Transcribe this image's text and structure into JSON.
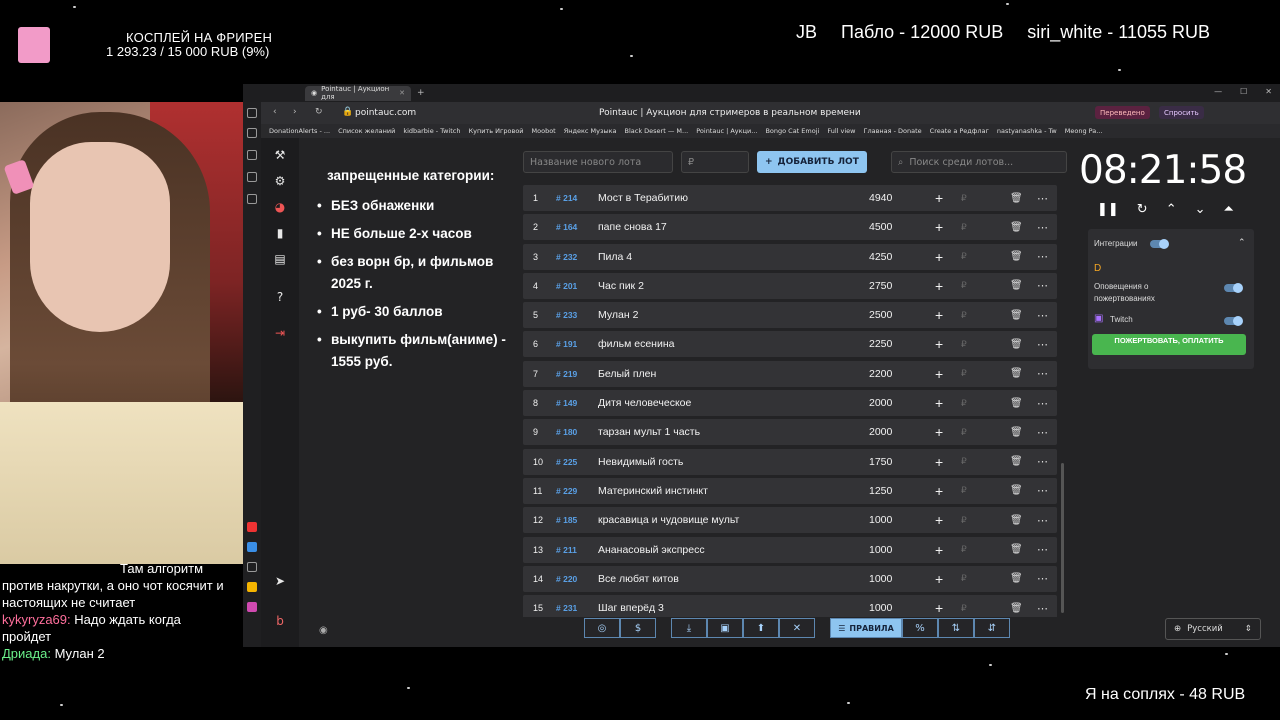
{
  "overlay": {
    "goal_title": "КОСПЛЕЙ НА ФРИРЕН",
    "goal_progress": "1 293.23 / 15 000 RUB (9%)",
    "top_donors": [
      "JB",
      "Пабло - 12000 RUB",
      "siri_white - 11055 RUB"
    ],
    "bottom_right": "Я на соплях - 48 RUB"
  },
  "chat": {
    "messages": [
      {
        "user": "",
        "text": "Там алгоритм"
      },
      {
        "user": "",
        "text": "против накрутки, а оно чот косячит и"
      },
      {
        "user": "",
        "text": "настоящих не считает"
      },
      {
        "user": "kykyryza69:",
        "text": "Надо ждать когда"
      },
      {
        "user": "",
        "text": "пройдет"
      },
      {
        "user": "Дриада:",
        "text": "Мулан 2"
      }
    ]
  },
  "browser": {
    "tab_title": "Pointauc | Аукцион для",
    "url": "pointauc.com",
    "page_title": "Pointauc | Аукцион для стримеров в реальном времени",
    "translated_badge": "Переведено",
    "ask_badge": "Спросить",
    "bookmarks": [
      "DonationAlerts - ...",
      "Список желаний",
      "kidbarbie - Twitch",
      "Купить Игровой",
      "Moobot",
      "Яндекс Музыка",
      "Black Desert — M...",
      "Pointauc | Аукци...",
      "Bongo Cat Emoji",
      "Full view",
      "Главная - Donate",
      "Create a Редфлаг",
      "nastyanashka - Tw",
      "Meong Pa..."
    ]
  },
  "rules": {
    "title": "запрещенные категории:",
    "items": [
      "БЕЗ обнаженки",
      "НЕ больше 2-х часов",
      "без ворн бр, и фильмов 2025 г.",
      "1 руб- 30 баллов",
      "выкупить фильм(аниме) - 1555 руб."
    ]
  },
  "toolbar": {
    "new_lot_placeholder": "Название нового лота",
    "amount_placeholder": "₽",
    "add_label": "ДОБАВИТЬ ЛОТ",
    "search_placeholder": "Поиск среди лотов..."
  },
  "lots": [
    {
      "num": "1",
      "id": "# 214",
      "name": "Мост в Терабитию",
      "amount": "4940"
    },
    {
      "num": "2",
      "id": "# 164",
      "name": "папе снова 17",
      "amount": "4500"
    },
    {
      "num": "3",
      "id": "# 232",
      "name": "Пила 4",
      "amount": "4250"
    },
    {
      "num": "4",
      "id": "# 201",
      "name": "Час пик 2",
      "amount": "2750"
    },
    {
      "num": "5",
      "id": "# 233",
      "name": "Мулан 2",
      "amount": "2500"
    },
    {
      "num": "6",
      "id": "# 191",
      "name": "фильм есенина",
      "amount": "2250"
    },
    {
      "num": "7",
      "id": "# 219",
      "name": "Белый плен",
      "amount": "2200"
    },
    {
      "num": "8",
      "id": "# 149",
      "name": "Дитя человеческое",
      "amount": "2000"
    },
    {
      "num": "9",
      "id": "# 180",
      "name": "тарзан мульт 1 часть",
      "amount": "2000"
    },
    {
      "num": "10",
      "id": "# 225",
      "name": "Невидимый гость",
      "amount": "1750"
    },
    {
      "num": "11",
      "id": "# 229",
      "name": "Материнский инстинкт",
      "amount": "1250"
    },
    {
      "num": "12",
      "id": "# 185",
      "name": "красавица и чудовище мульт",
      "amount": "1000"
    },
    {
      "num": "13",
      "id": "# 211",
      "name": "Ананасовый экспресс",
      "amount": "1000"
    },
    {
      "num": "14",
      "id": "# 220",
      "name": "Все любят китов",
      "amount": "1000"
    },
    {
      "num": "15",
      "id": "# 231",
      "name": "Шаг вперёд 3",
      "amount": "1000"
    }
  ],
  "timer": "08:21:58",
  "integrations": {
    "title": "Интеграции",
    "donations_label": "Оповещения о пожертвованиях",
    "twitch_label": "Twitch",
    "donate_button": "ПОЖЕРТВОВАТЬ, ОПЛАТИТЬ"
  },
  "bottom": {
    "rules_label": "ПРАВИЛА",
    "language": "Русский"
  },
  "colors": {
    "accent": "#8ec5f0",
    "lot_id": "#5aa0e6",
    "donate_green": "#49b64f",
    "goal_pink": "#f29bc8"
  }
}
